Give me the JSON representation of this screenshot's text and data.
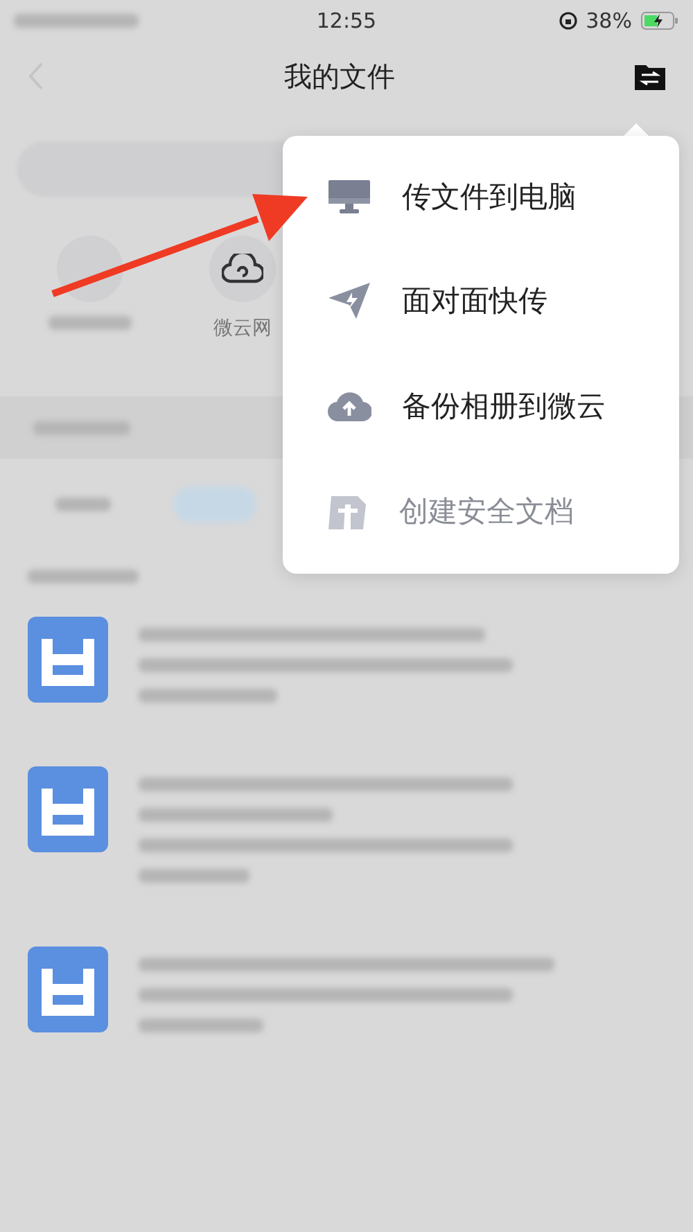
{
  "status_bar": {
    "time": "12:55",
    "battery_text": "38%"
  },
  "nav": {
    "title": "我的文件"
  },
  "quick_access": [
    {
      "label": "微云网"
    }
  ],
  "menu": {
    "items": [
      {
        "kind": "computer",
        "label": "传文件到电脑",
        "disabled": false
      },
      {
        "kind": "send",
        "label": "面对面快传",
        "disabled": false
      },
      {
        "kind": "cloud",
        "label": "备份相册到微云",
        "disabled": false
      },
      {
        "kind": "secure",
        "label": "创建安全文档",
        "disabled": true
      }
    ]
  }
}
